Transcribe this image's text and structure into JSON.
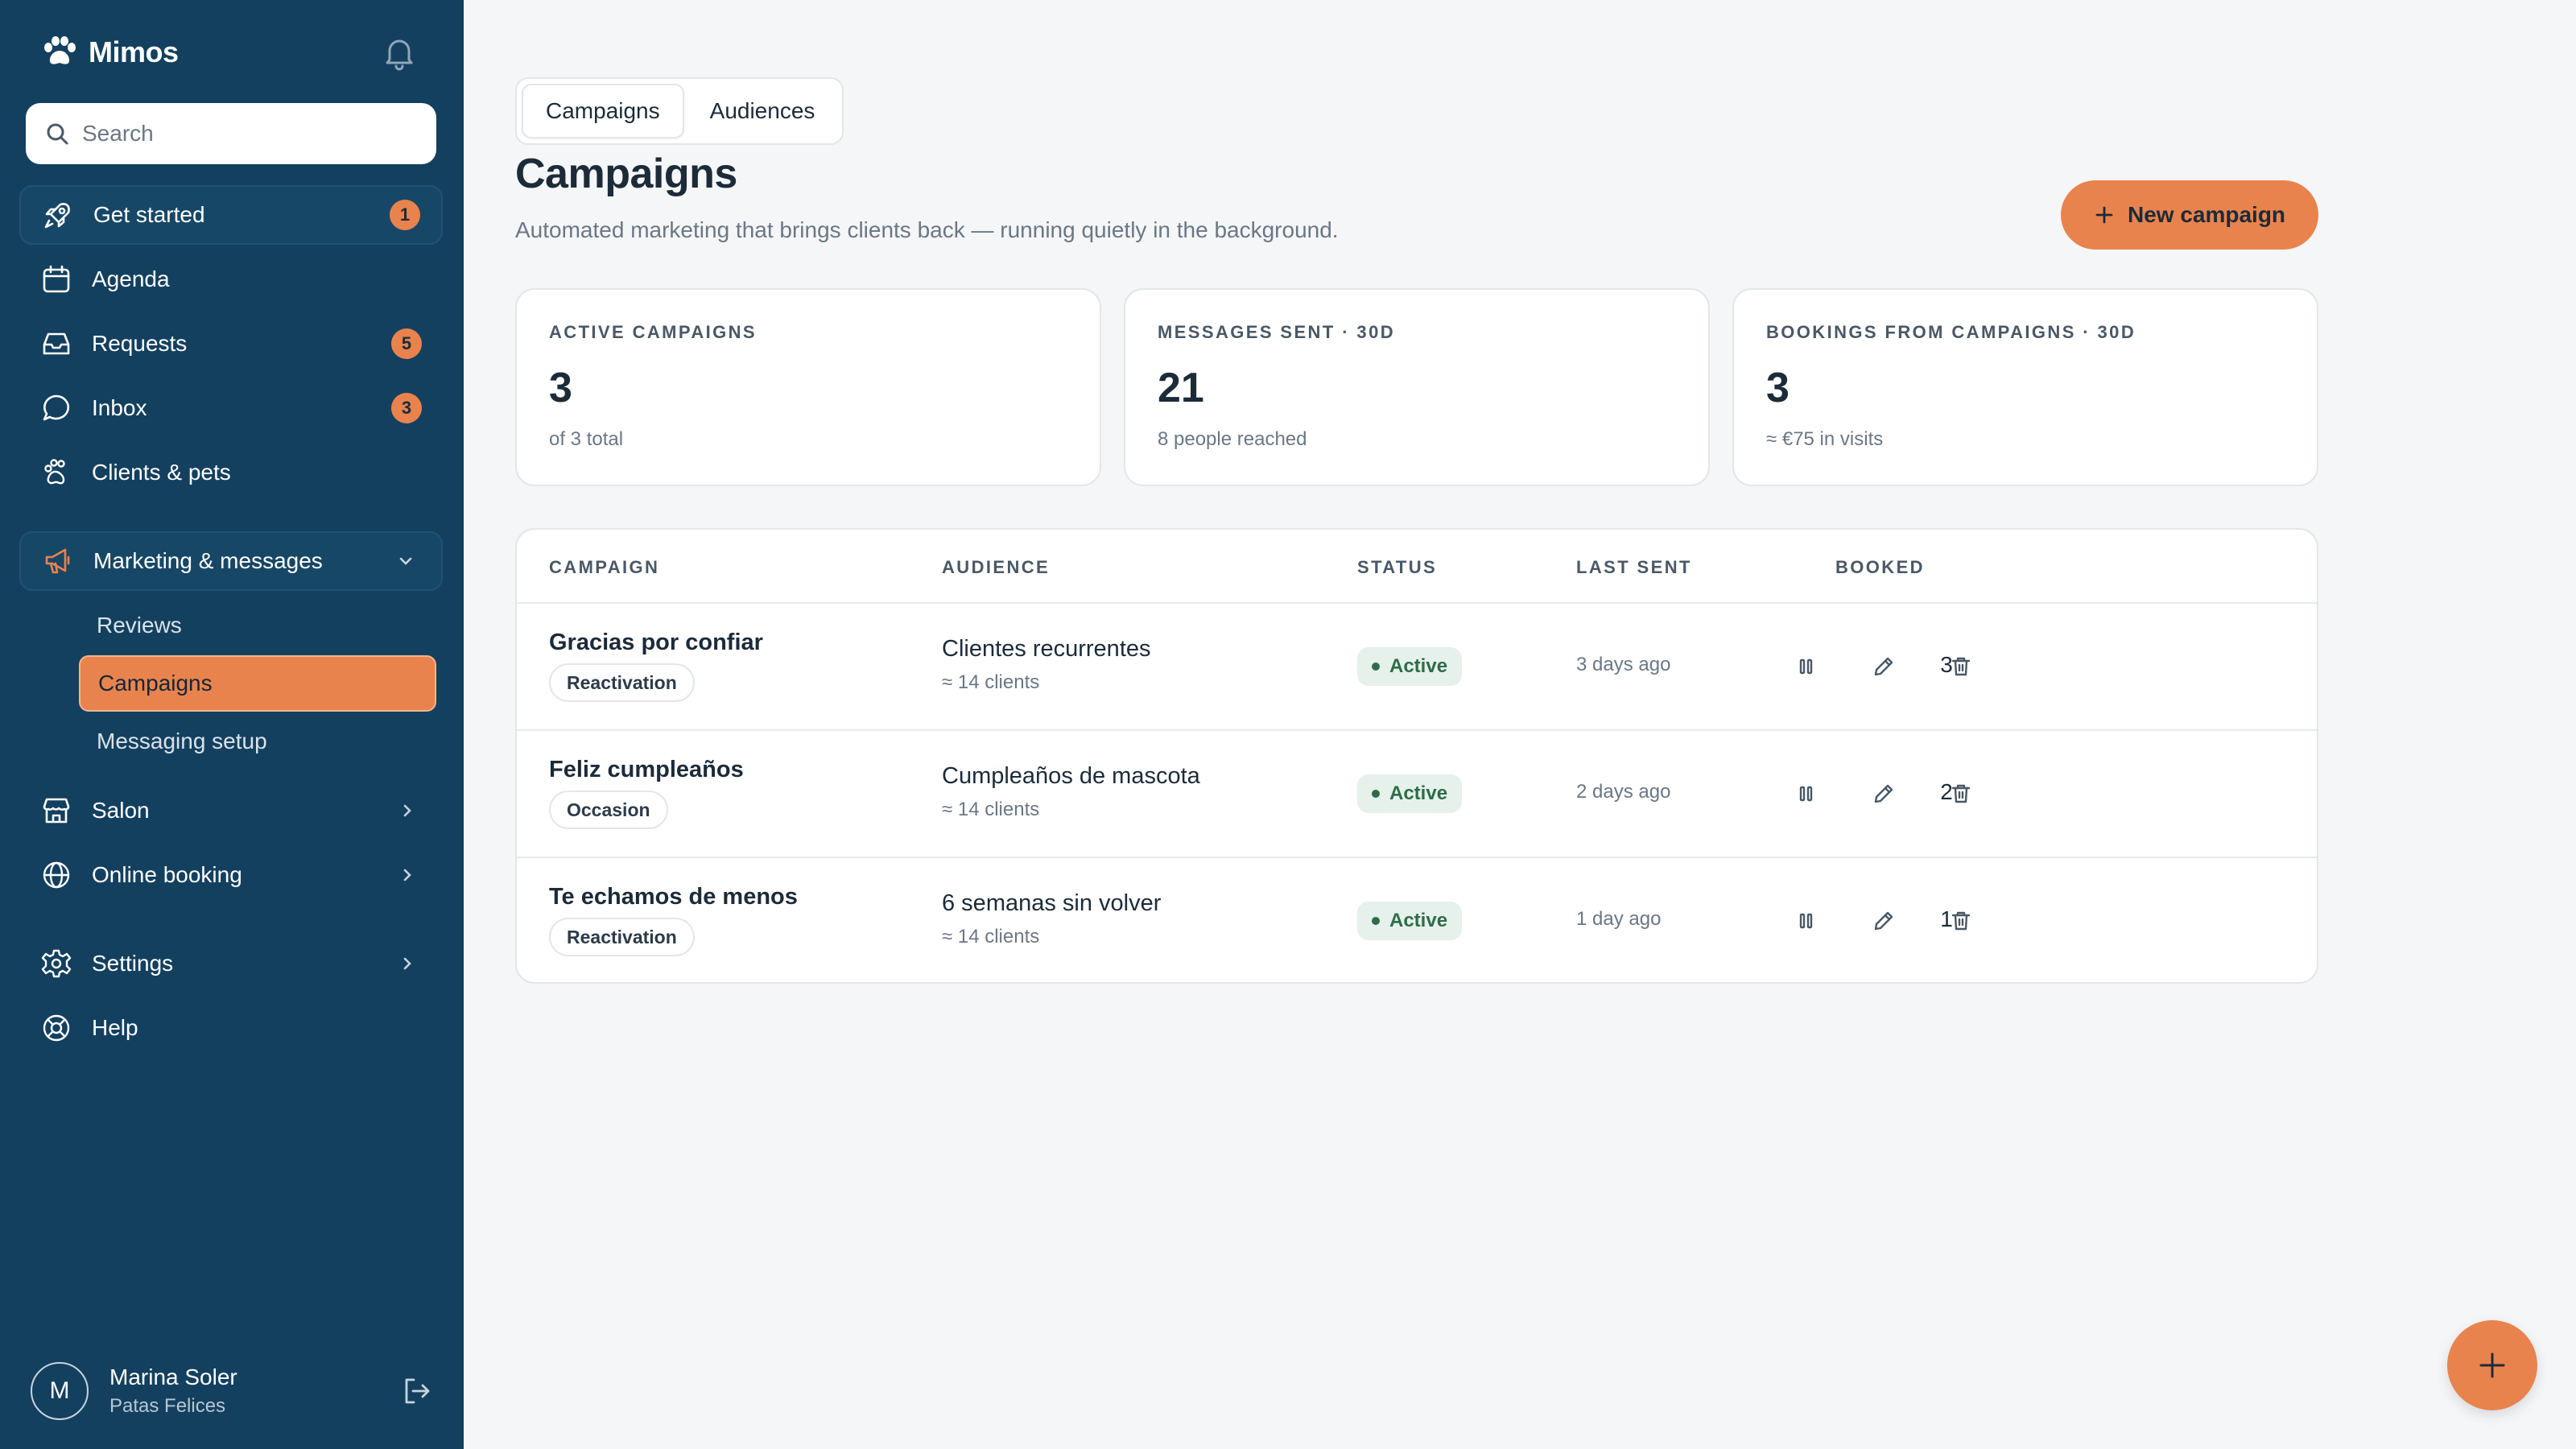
{
  "sidebar": {
    "brand": "Mimos",
    "search_placeholder": "Search",
    "items": [
      {
        "label": "Get started",
        "badge": "1"
      },
      {
        "label": "Agenda"
      },
      {
        "label": "Requests",
        "badge": "5"
      },
      {
        "label": "Inbox",
        "badge": "3"
      },
      {
        "label": "Clients & pets"
      },
      {
        "label": "Marketing & messages"
      },
      {
        "label": "Salon"
      },
      {
        "label": "Online booking"
      },
      {
        "label": "Settings"
      },
      {
        "label": "Help"
      }
    ],
    "sub_items": [
      {
        "label": "Reviews"
      },
      {
        "label": "Campaigns"
      },
      {
        "label": "Messaging setup"
      }
    ],
    "user": {
      "initial": "M",
      "name": "Marina Soler",
      "org": "Patas Felices"
    }
  },
  "main": {
    "tabs": [
      {
        "label": "Campaigns"
      },
      {
        "label": "Audiences"
      }
    ],
    "title": "Campaigns",
    "subtitle": "Automated marketing that brings clients back — running quietly in the background.",
    "new_button": "New campaign",
    "stats": [
      {
        "label": "ACTIVE CAMPAIGNS",
        "value": "3",
        "note": "of 3 total"
      },
      {
        "label": "MESSAGES SENT · 30D",
        "value": "21",
        "note": "8 people reached"
      },
      {
        "label": "BOOKINGS FROM CAMPAIGNS · 30D",
        "value": "3",
        "note": "≈ €75 in visits"
      }
    ],
    "table": {
      "headers": [
        "CAMPAIGN",
        "AUDIENCE",
        "STATUS",
        "LAST SENT",
        "BOOKED"
      ],
      "rows": [
        {
          "name": "Gracias por confiar",
          "tag": "Reactivation",
          "audience": "Clientes recurrentes",
          "audience_size": "≈ 14 clients",
          "status": "Active",
          "last_sent": "3 days ago",
          "booked": "3"
        },
        {
          "name": "Feliz cumpleaños",
          "tag": "Occasion",
          "audience": "Cumpleaños de mascota",
          "audience_size": "≈ 14 clients",
          "status": "Active",
          "last_sent": "2 days ago",
          "booked": "2"
        },
        {
          "name": "Te echamos de menos",
          "tag": "Reactivation",
          "audience": "6 semanas sin volver",
          "audience_size": "≈ 14 clients",
          "status": "Active",
          "last_sent": "1 day ago",
          "booked": "1"
        }
      ]
    }
  },
  "colors": {
    "sidebar": "#14405f",
    "accent": "#e9834d",
    "status_active_bg": "#e5f1ea",
    "status_active_text": "#2f6b4a"
  }
}
